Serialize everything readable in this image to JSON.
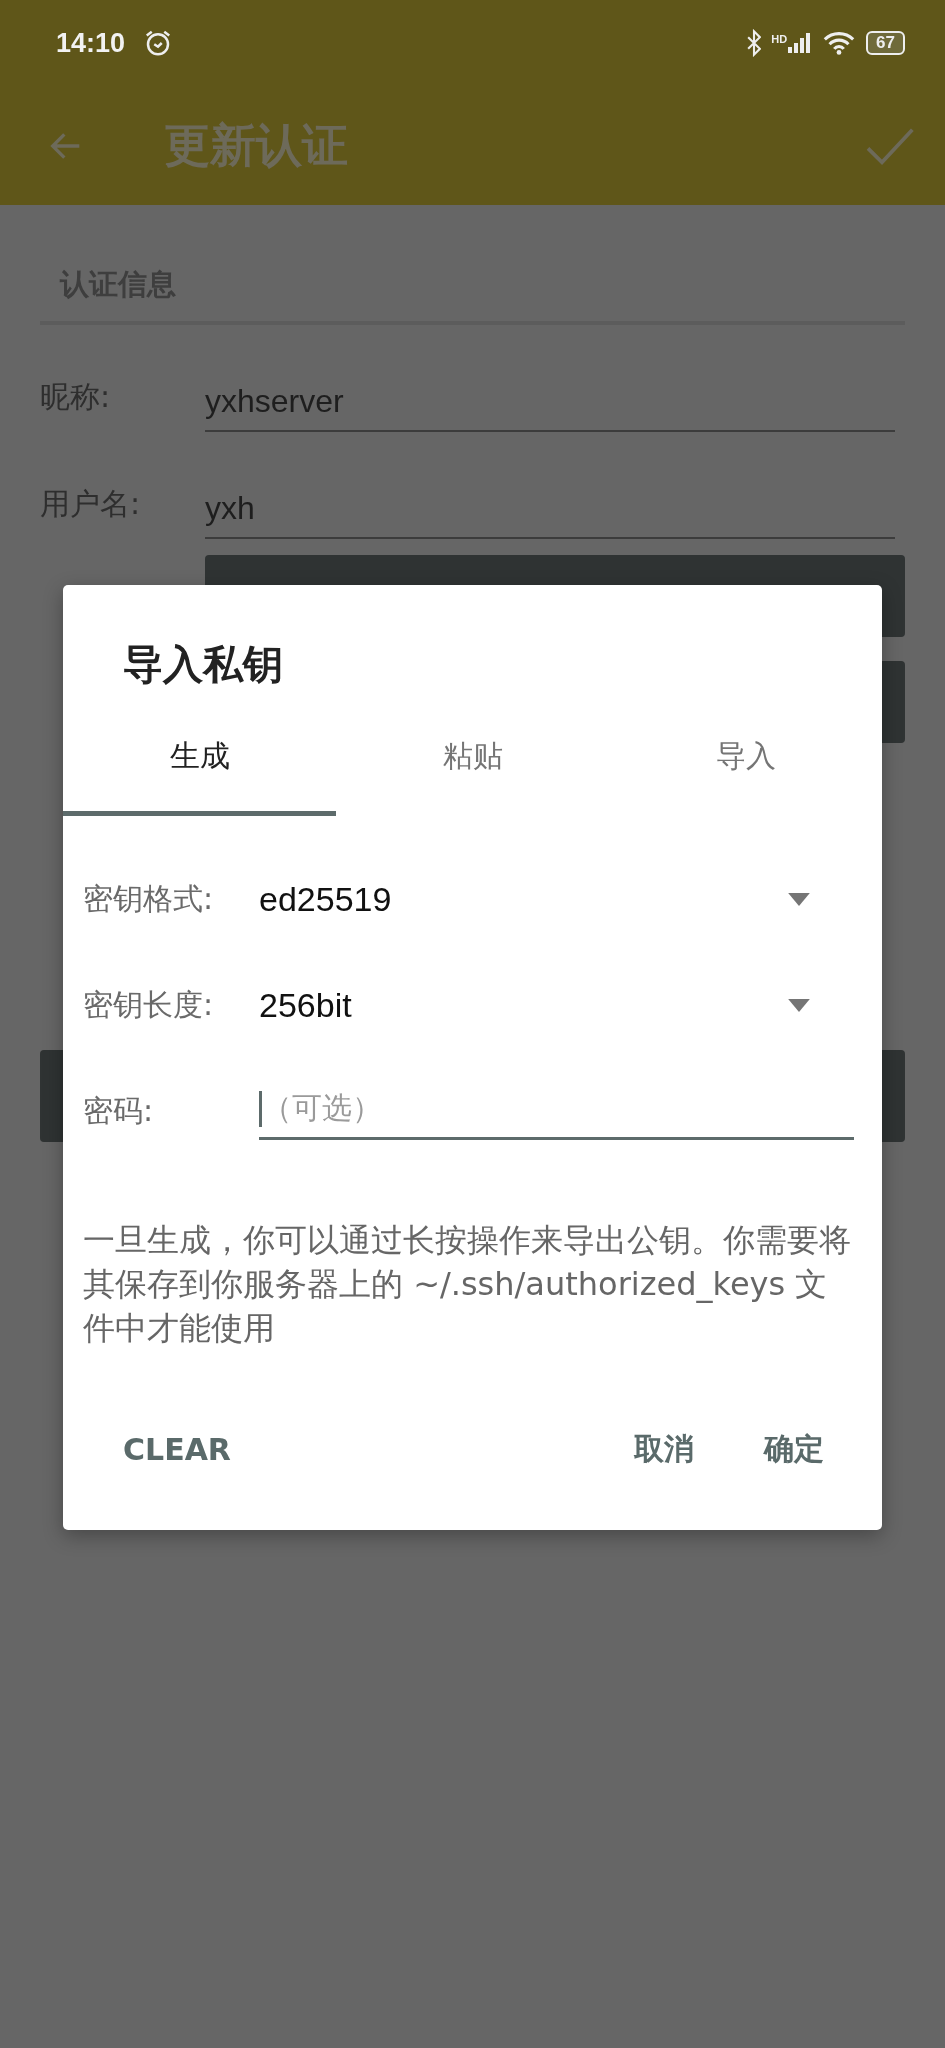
{
  "status_bar": {
    "time": "14:10",
    "network_label": "HD",
    "battery": "67"
  },
  "app_bar": {
    "title": "更新认证"
  },
  "form": {
    "section_title": "认证信息",
    "fields": [
      {
        "label": "昵称:",
        "value": "yxhserver"
      },
      {
        "label": "用户名:",
        "value": "yxh"
      }
    ]
  },
  "dialog": {
    "title": "导入私钥",
    "tabs": [
      {
        "label": "生成",
        "selected": true
      },
      {
        "label": "粘贴",
        "selected": false
      },
      {
        "label": "导入",
        "selected": false
      }
    ],
    "rows": [
      {
        "kind": "dropdown",
        "label": "密钥格式:",
        "value": "ed25519"
      },
      {
        "kind": "dropdown",
        "label": "密钥长度:",
        "value": "256bit"
      },
      {
        "kind": "input",
        "label": "密码:",
        "placeholder": "（可选）",
        "focused": true
      }
    ],
    "note": "一旦生成，你可以通过长按操作来导出公钥。你需要将其保存到你服务器上的 ~/.ssh/authorized_keys 文件中才能使用",
    "buttons": [
      "CLEAR",
      "取消",
      "确定"
    ]
  }
}
